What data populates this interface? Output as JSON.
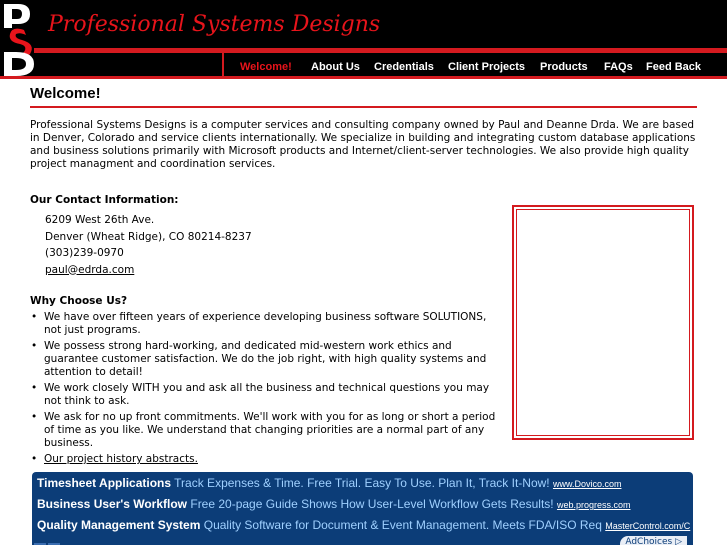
{
  "header": {
    "logo_letters": [
      "P",
      "S",
      "D"
    ],
    "site_title": "Professional Systems Designs",
    "nav": [
      {
        "label": "Welcome!",
        "active": true
      },
      {
        "label": "About Us",
        "active": false
      },
      {
        "label": "Credentials",
        "active": false
      },
      {
        "label": "Client Projects",
        "active": false
      },
      {
        "label": "Products",
        "active": false
      },
      {
        "label": "FAQs",
        "active": false
      },
      {
        "label": "Feed Back",
        "active": false
      }
    ]
  },
  "main": {
    "title": "Welcome!",
    "intro": "Professional Systems Designs is a computer services and consulting company owned by Paul and Deanne Drda. We are based in Denver, Colorado and service clients internationally. We specialize in building and integrating custom database applications and business solutions primarily with Microsoft products and Internet/client-server technologies. We also provide high quality project managment and coordination services.",
    "contact": {
      "heading": "Our Contact Information:",
      "address1": "6209 West 26th Ave.",
      "address2": "Denver (Wheat Ridge), CO 80214-8237",
      "phone": "(303)239-0970",
      "email": "paul@edrda.com"
    },
    "why": {
      "heading": "Why Choose Us?",
      "items": [
        "We have over fifteen years of experience developing business software SOLUTIONS, not just programs.",
        "We possess strong hard-working, and dedicated mid-western work ethics and guarantee customer satisfaction. We do the job right, with high quality systems and attention to detail!",
        "We work closely WITH you and ask all the business and technical questions you may not think to ask.",
        "We ask for no up front commitments. We'll work with you for as long or short a period of time as you like. We understand that changing priorities are a normal part of any business.",
        "Our project history abstracts."
      ]
    }
  },
  "ads": {
    "rows": [
      {
        "title": "Timesheet Applications",
        "text": "Track Expenses & Time. Free Trial. Easy To Use. Plan It, Track It-Now!",
        "url": "www.Dovico.com"
      },
      {
        "title": "Business User's Workflow",
        "text": "Free 20-page Guide Shows How User-Level Workflow Gets Results!",
        "url": "web.progress.com"
      },
      {
        "title": "Quality Management System",
        "text": "Quality Software for Document & Event Management. Meets FDA/ISO Req",
        "url": "MasterControl.com/C"
      }
    ],
    "prev": "◀",
    "next": "▶",
    "adchoices": "AdChoices ▷"
  },
  "colors": {
    "accent_red": "#d41a1f",
    "ad_background": "#0c3d78"
  }
}
